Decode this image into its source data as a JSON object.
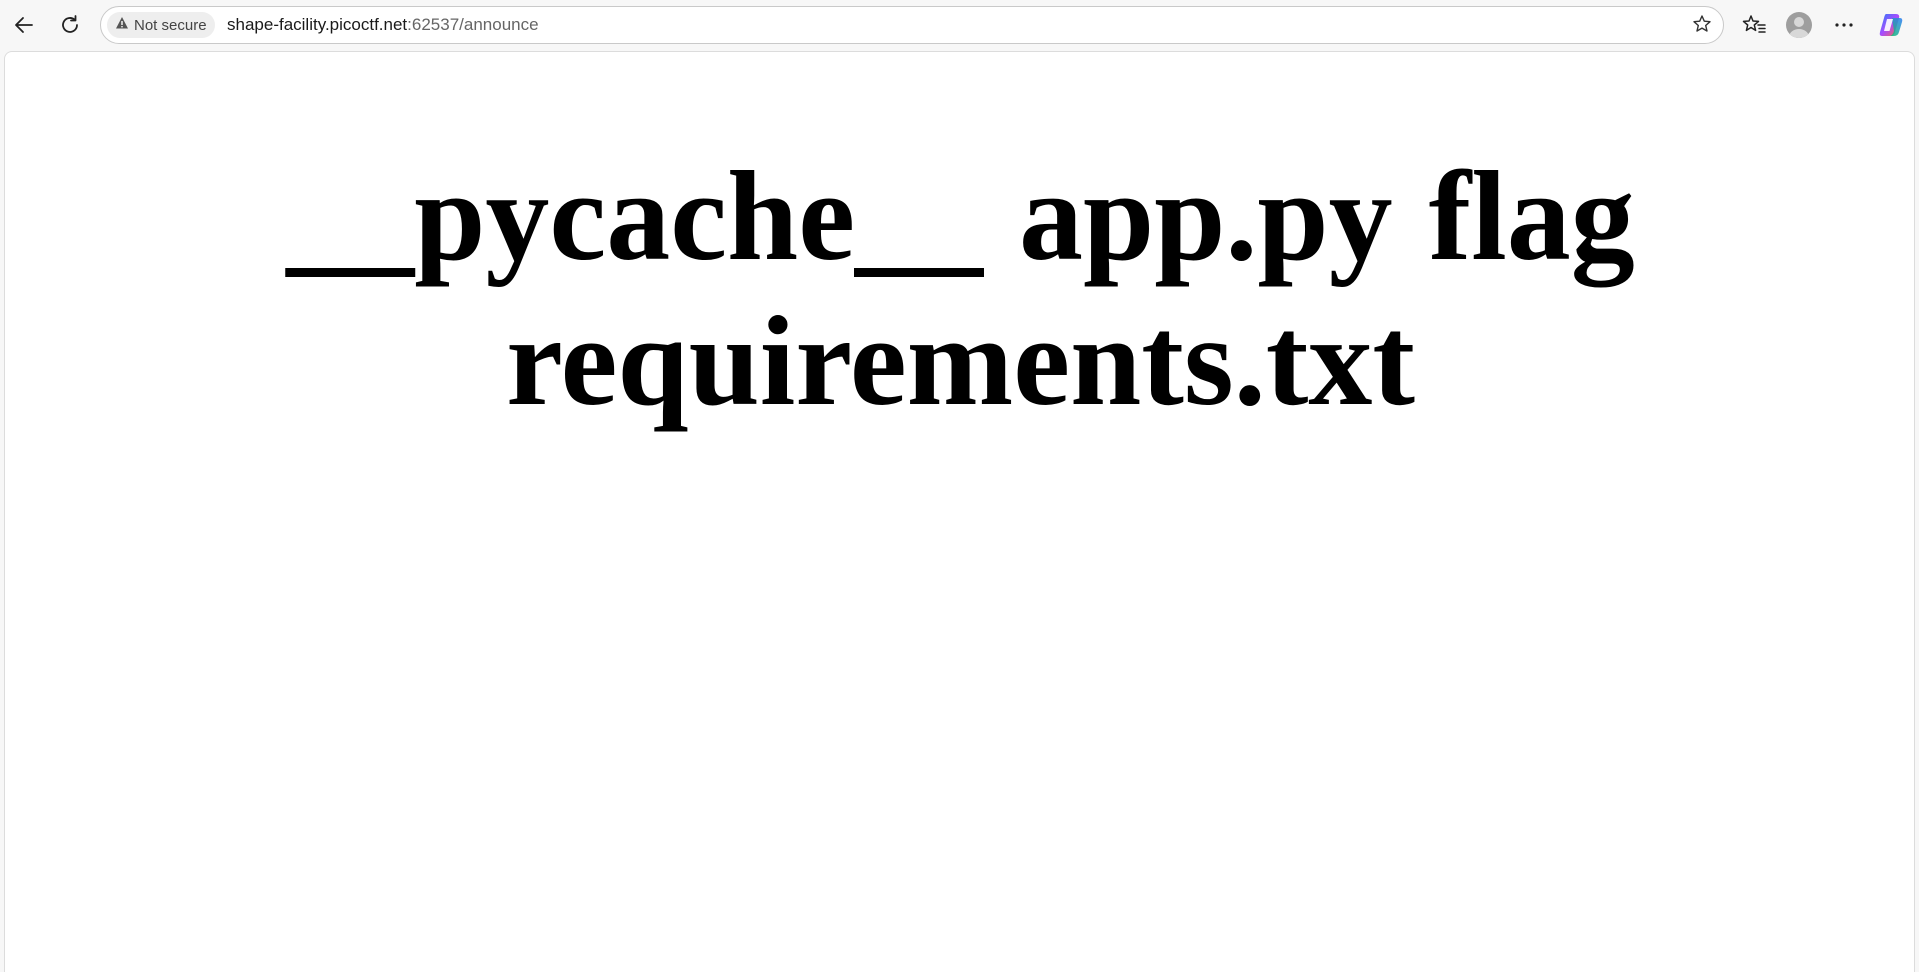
{
  "browser": {
    "security_label": "Not secure",
    "url_host": "shape-facility.picoctf.net",
    "url_rest": ":62537/announce",
    "icons": {
      "back": "back-arrow-icon",
      "reload": "reload-icon",
      "security": "warning-triangle-icon",
      "star": "star-icon",
      "favorites": "favorites-icon",
      "profile": "profile-avatar-icon",
      "more": "more-dots-icon",
      "copilot": "copilot-icon"
    }
  },
  "page": {
    "heading": "__pycache__ app.py flag requirements.txt"
  }
}
